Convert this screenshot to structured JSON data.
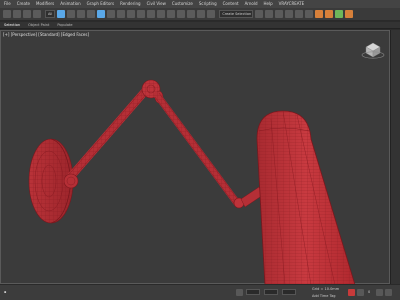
{
  "menubar": {
    "items": [
      "File",
      "Create",
      "Modifiers",
      "Animation",
      "Graph Editors",
      "Rendering",
      "Civil View",
      "Customize",
      "Scripting",
      "Content",
      "Arnold",
      "Help",
      "VRAYCREATE"
    ]
  },
  "toolbar": {
    "selection_filter": "All",
    "selection_set": "Create Selection Se"
  },
  "ribbon": {
    "tabs": [
      "Selection",
      "Object Paint",
      "Populate"
    ],
    "active_index": 0
  },
  "viewport": {
    "label": "[+] [Perspective] [Standard] [Edged Faces]",
    "mesh_color": "#c2343a",
    "wire_color": "#8a1b22",
    "background": "#3b3b3b"
  },
  "statusbar": {
    "grid_text": "Grid = 10.0mm",
    "add_time_tag": "Add Time Tag",
    "frame": "0"
  }
}
